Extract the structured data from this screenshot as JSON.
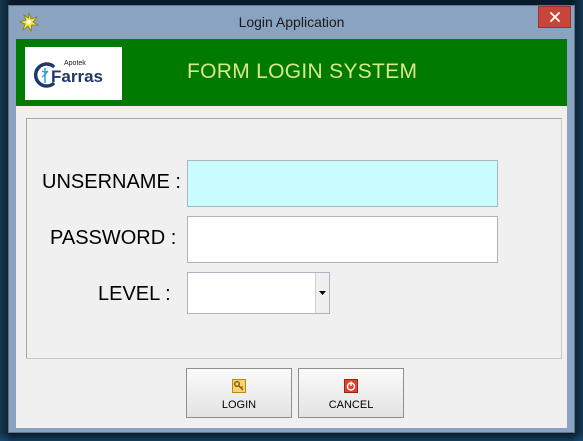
{
  "window": {
    "title": "Login Application",
    "app_icon": "star-burst-icon",
    "close_icon": "close-icon"
  },
  "header": {
    "logo": {
      "small_text": "Apotek",
      "brand_text": "Farras",
      "mark_icon": "caduceus-c-icon"
    },
    "title": "FORM LOGIN SYSTEM"
  },
  "form": {
    "username_label": "UNSERNAME :",
    "username_value": "",
    "password_label": "PASSWORD :",
    "password_value": "",
    "level_label": "LEVEL :",
    "level_value": ""
  },
  "buttons": {
    "login_label": "LOGIN",
    "login_icon": "key-icon",
    "cancel_label": "CANCEL",
    "cancel_icon": "power-icon"
  },
  "colors": {
    "header_bg": "#007a00",
    "header_title": "#d8e88a",
    "username_bg": "#c8fcff",
    "titlebar": "#8aa3c0",
    "close_button": "#c7463a"
  }
}
